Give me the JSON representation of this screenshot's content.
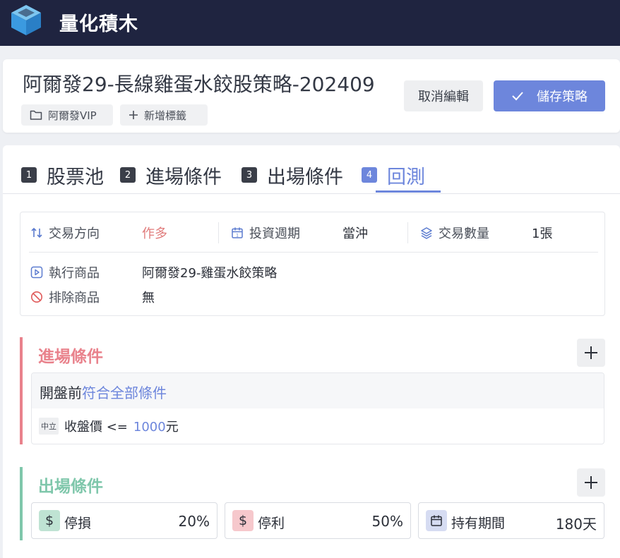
{
  "app": {
    "title": "量化積木"
  },
  "header": {
    "strategy_title": "阿爾發29-長線雞蛋水餃股策略-202409",
    "tags": [
      {
        "label": "阿爾發VIP",
        "icon": "folder-icon"
      },
      {
        "label": "新增標籤",
        "icon": "plus-icon"
      }
    ],
    "cancel_label": "取消編輯",
    "save_label": "儲存策略"
  },
  "tabs": [
    {
      "num": "1",
      "label": "股票池"
    },
    {
      "num": "2",
      "label": "進場條件"
    },
    {
      "num": "3",
      "label": "出場條件"
    },
    {
      "num": "4",
      "label": "回測",
      "active": true
    }
  ],
  "info": {
    "direction_label": "交易方向",
    "direction_value": "作多",
    "period_label": "投資週期",
    "period_value": "當沖",
    "quantity_label": "交易數量",
    "quantity_value": "1張",
    "target_label": "執行商品",
    "target_value": "阿爾發29-雞蛋水餃策略",
    "exclude_label": "排除商品",
    "exclude_value": "無"
  },
  "entry": {
    "title": "進場條件",
    "head_prefix": "開盤前",
    "head_link": "符合全部條件",
    "condition": {
      "badge": "中立",
      "text": "收盤價 <=",
      "value": "1000",
      "unit": "元"
    }
  },
  "exit": {
    "title": "出場條件",
    "items": [
      {
        "label": "停損",
        "value": "20%",
        "icon": "dollar-icon"
      },
      {
        "label": "停利",
        "value": "50%",
        "icon": "dollar-icon"
      },
      {
        "label": "持有期間",
        "value": "180天",
        "icon": "calendar-icon"
      }
    ]
  },
  "colors": {
    "accent": "#6d86dc",
    "entry": "#e9828c",
    "exit": "#7fc7ab",
    "nav": "#1f2440"
  }
}
